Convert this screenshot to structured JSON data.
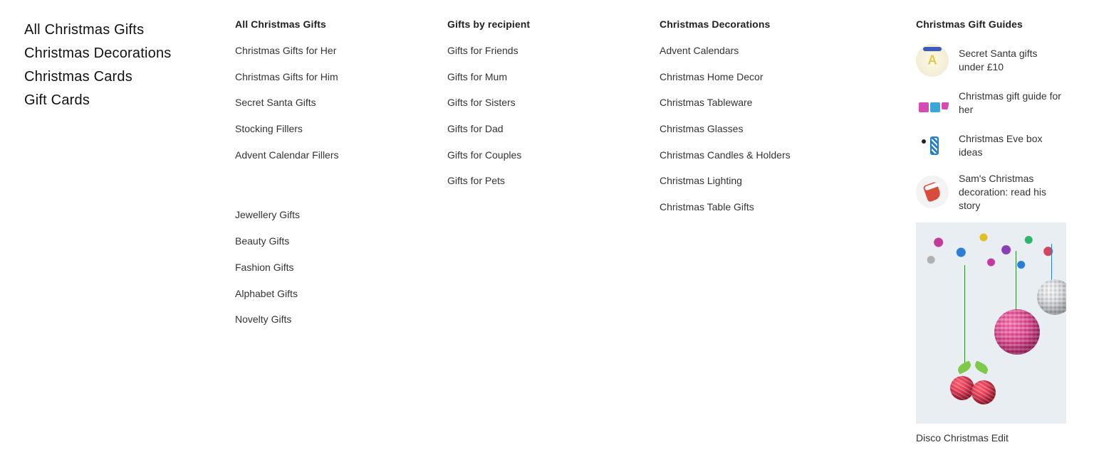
{
  "primaryNav": [
    "All Christmas Gifts",
    "Christmas Decorations",
    "Christmas Cards",
    "Gift Cards"
  ],
  "col_allgifts": {
    "heading": "All Christmas Gifts",
    "group1": [
      "Christmas Gifts for Her",
      "Christmas Gifts for Him",
      "Secret Santa Gifts",
      "Stocking Fillers",
      "Advent Calendar Fillers"
    ],
    "group2": [
      "Jewellery Gifts",
      "Beauty Gifts",
      "Fashion Gifts",
      "Alphabet Gifts",
      "Novelty Gifts"
    ]
  },
  "col_recipient": {
    "heading": "Gifts by recipient",
    "items": [
      "Gifts for Friends",
      "Gifts for Mum",
      "Gifts for Sisters",
      "Gifts for Dad",
      "Gifts for Couples",
      "Gifts for Pets"
    ]
  },
  "col_decor": {
    "heading": "Christmas Decorations",
    "items": [
      "Advent Calendars",
      "Christmas Home Decor",
      "Christmas Tableware",
      "Christmas Glasses",
      "Christmas Candles & Holders",
      "Christmas Lighting",
      "Christmas Table Gifts"
    ]
  },
  "col_guides": {
    "heading": "Christmas Gift Guides",
    "items": [
      "Secret Santa gifts under £10",
      "Christmas gift guide for her",
      "Christmas Eve box ideas",
      "Sam's Christmas decoration: read his story"
    ],
    "promo_caption": "Disco Christmas Edit"
  }
}
